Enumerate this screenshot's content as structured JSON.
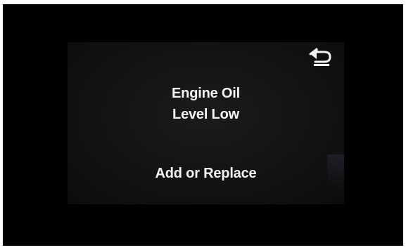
{
  "display": {
    "warning_title_line1": "Engine Oil",
    "warning_title_line2": "Level Low",
    "action_text": "Add or Replace",
    "back_icon": "back-arrow-icon"
  },
  "colors": {
    "screen_background": "#141414",
    "text": "#f4f4f4"
  }
}
